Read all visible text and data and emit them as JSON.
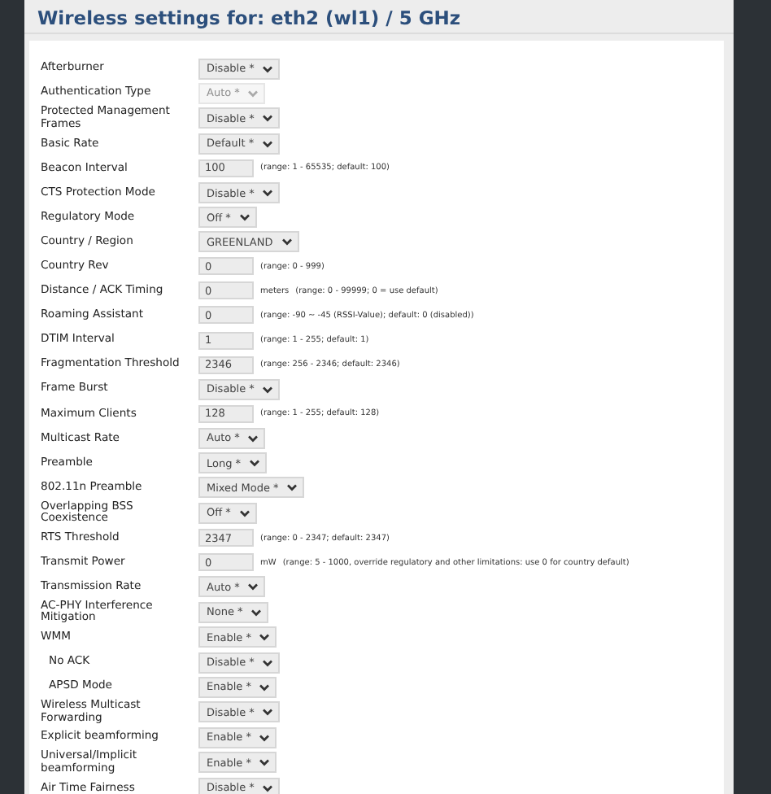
{
  "title": "Wireless settings for: eth2 (wl1) / 5 GHz",
  "rows": [
    {
      "label": "Afterburner",
      "kind": "select",
      "value": "Disable *",
      "disabled": false
    },
    {
      "label": "Authentication Type",
      "kind": "select",
      "value": "Auto *",
      "disabled": true
    },
    {
      "label": "Protected Management Frames",
      "kind": "select",
      "value": "Disable *",
      "disabled": false
    },
    {
      "label": "Basic Rate",
      "kind": "select",
      "value": "Default *",
      "disabled": false
    },
    {
      "label": "Beacon Interval",
      "kind": "input",
      "value": "100",
      "hint": "(range: 1 - 65535; default: 100)"
    },
    {
      "label": "CTS Protection Mode",
      "kind": "select",
      "value": "Disable *",
      "disabled": false
    },
    {
      "label": "Regulatory Mode",
      "kind": "select",
      "value": "Off *",
      "disabled": false
    },
    {
      "label": "Country / Region",
      "kind": "select",
      "value": "GREENLAND",
      "disabled": false
    },
    {
      "label": "Country Rev",
      "kind": "input",
      "value": "0",
      "hint": "(range: 0 - 999)"
    },
    {
      "label": "Distance / ACK Timing",
      "kind": "input",
      "value": "0",
      "unit": "meters",
      "hint": "(range: 0 - 99999; 0 = use default)"
    },
    {
      "label": "Roaming Assistant",
      "kind": "input",
      "value": "0",
      "hint": "(range: -90 ~ -45 (RSSI-Value); default: 0 (disabled))"
    },
    {
      "label": "DTIM Interval",
      "kind": "input",
      "value": "1",
      "hint": "(range: 1 - 255; default: 1)"
    },
    {
      "label": "Fragmentation Threshold",
      "kind": "input",
      "value": "2346",
      "hint": "(range: 256 - 2346; default: 2346)"
    },
    {
      "label": "Frame Burst",
      "kind": "select",
      "value": "Disable *",
      "disabled": false
    },
    {
      "label": "Maximum Clients",
      "kind": "input",
      "value": "128",
      "hint": "(range: 1 - 255; default: 128)"
    },
    {
      "label": "Multicast Rate",
      "kind": "select",
      "value": "Auto *",
      "disabled": false
    },
    {
      "label": "Preamble",
      "kind": "select",
      "value": "Long *",
      "disabled": false
    },
    {
      "label": "802.11n Preamble",
      "kind": "select",
      "value": "Mixed Mode *",
      "disabled": false
    },
    {
      "label": "Overlapping BSS Coexistence",
      "kind": "select",
      "value": "Off *",
      "disabled": false
    },
    {
      "label": "RTS Threshold",
      "kind": "input",
      "value": "2347",
      "hint": "(range: 0 - 2347; default: 2347)"
    },
    {
      "label": "Transmit Power",
      "kind": "input",
      "value": "0",
      "unit": "mW",
      "hint": "(range: 5 - 1000, override regulatory and other limitations: use 0 for country default)"
    },
    {
      "label": "Transmission Rate",
      "kind": "select",
      "value": "Auto *",
      "disabled": false
    },
    {
      "label": "AC-PHY Interference Mitigation",
      "kind": "select",
      "value": "None *",
      "disabled": false
    },
    {
      "label": "WMM",
      "kind": "select",
      "value": "Enable *",
      "disabled": false,
      "children": [
        {
          "label": "No ACK",
          "kind": "select",
          "value": "Disable *",
          "disabled": false
        },
        {
          "label": "APSD Mode",
          "kind": "select",
          "value": "Enable *",
          "disabled": false
        }
      ]
    },
    {
      "label": "Wireless Multicast Forwarding",
      "kind": "select",
      "value": "Disable *",
      "disabled": false
    },
    {
      "label": "Explicit beamforming",
      "kind": "select",
      "value": "Enable *",
      "disabled": false
    },
    {
      "label": "Universal/Implicit beamforming",
      "kind": "select",
      "value": "Enable *",
      "disabled": false
    },
    {
      "label": "Air Time Fairness",
      "kind": "select",
      "value": "Disable *",
      "disabled": false
    }
  ]
}
